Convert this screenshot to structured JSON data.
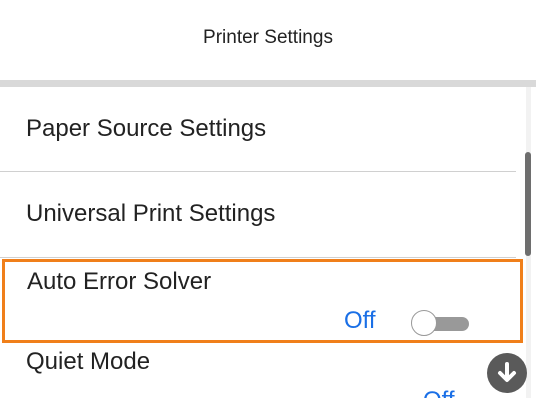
{
  "header": {
    "title": "Printer Settings"
  },
  "menu": {
    "items": [
      {
        "label": "Paper Source Settings"
      },
      {
        "label": "Universal Print Settings"
      },
      {
        "label": "Auto Error Solver",
        "value": "Off",
        "toggle_on": false,
        "selected": true
      },
      {
        "label": "Quiet Mode",
        "value_partial": "Off"
      }
    ]
  },
  "colors": {
    "accent_selection": "#f07f1a",
    "value_text": "#1a6fe6",
    "toggle_off": "#999999",
    "scroll_button": "#5a5a5a"
  },
  "icons": {
    "scroll_down": "arrow-down-circle-icon"
  }
}
